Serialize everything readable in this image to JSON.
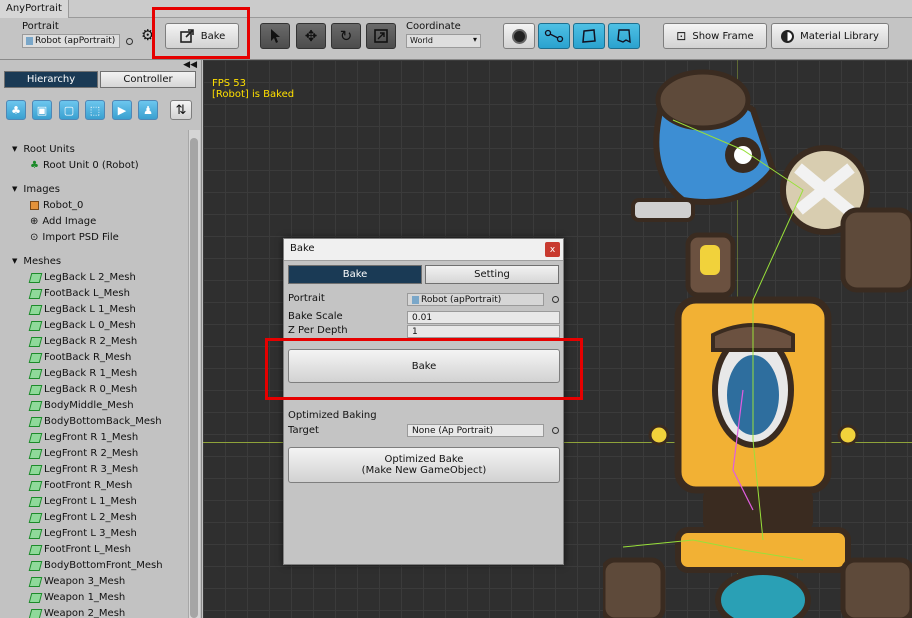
{
  "window": {
    "tab_title": "AnyPortrait"
  },
  "toolbar": {
    "portrait_label": "Portrait",
    "portrait_value": "Robot (apPortrait)",
    "bake_label": "Bake",
    "coordinate_label": "Coordinate",
    "coordinate_value": "World",
    "show_frame_label": "Show Frame",
    "material_library_label": "Material Library"
  },
  "sidebar": {
    "tabs": [
      {
        "label": "Hierarchy",
        "active": true
      },
      {
        "label": "Controller",
        "active": false
      }
    ],
    "collapse_glyph": "◀◀",
    "sort_glyph": "⇅",
    "groups": [
      {
        "label": "Root Units",
        "items": [
          {
            "label": "Root Unit 0 (Robot)",
            "icon": "root-unit-icon"
          }
        ]
      },
      {
        "label": "Images",
        "items": [
          {
            "label": "Robot_0",
            "icon": "image-icon"
          },
          {
            "label": "Add Image",
            "icon": "add-icon"
          },
          {
            "label": "Import PSD File",
            "icon": "import-icon"
          }
        ]
      },
      {
        "label": "Meshes",
        "items": [
          {
            "label": "LegBack L 2_Mesh"
          },
          {
            "label": "FootBack L_Mesh"
          },
          {
            "label": "LegBack L 1_Mesh"
          },
          {
            "label": "LegBack L 0_Mesh"
          },
          {
            "label": "LegBack R 2_Mesh"
          },
          {
            "label": "FootBack R_Mesh"
          },
          {
            "label": "LegBack R 1_Mesh"
          },
          {
            "label": "LegBack R 0_Mesh"
          },
          {
            "label": "BodyMiddle_Mesh"
          },
          {
            "label": "BodyBottomBack_Mesh"
          },
          {
            "label": "LegFront R 1_Mesh"
          },
          {
            "label": "LegFront R 2_Mesh"
          },
          {
            "label": "LegFront R 3_Mesh"
          },
          {
            "label": "FootFront R_Mesh"
          },
          {
            "label": "LegFront L 1_Mesh"
          },
          {
            "label": "LegFront L 2_Mesh"
          },
          {
            "label": "LegFront L 3_Mesh"
          },
          {
            "label": "FootFront L_Mesh"
          },
          {
            "label": "BodyBottomFront_Mesh"
          },
          {
            "label": "Weapon 3_Mesh"
          },
          {
            "label": "Weapon 1_Mesh"
          },
          {
            "label": "Weapon 2_Mesh"
          }
        ]
      }
    ]
  },
  "viewport": {
    "fps": "FPS 53",
    "status": "[Robot] is Baked"
  },
  "bake_dialog": {
    "title": "Bake",
    "close_glyph": "x",
    "tabs": [
      {
        "label": "Bake",
        "active": true
      },
      {
        "label": "Setting",
        "active": false
      }
    ],
    "portrait_label": "Portrait",
    "portrait_value": "Robot (apPortrait)",
    "bake_scale_label": "Bake Scale",
    "bake_scale_value": "0.01",
    "z_per_depth_label": "Z Per Depth",
    "z_per_depth_value": "1",
    "bake_button": "Bake",
    "optimized_heading": "Optimized Baking",
    "target_label": "Target",
    "target_value": "None (Ap Portrait)",
    "optimized_button_line1": "Optimized Bake",
    "optimized_button_line2": "(Make New GameObject)"
  },
  "colors": {
    "highlight": "#e60000",
    "tab_active": "#1a3a55",
    "fps_text": "#ffe000",
    "tool_active": "#2aa2cf"
  }
}
